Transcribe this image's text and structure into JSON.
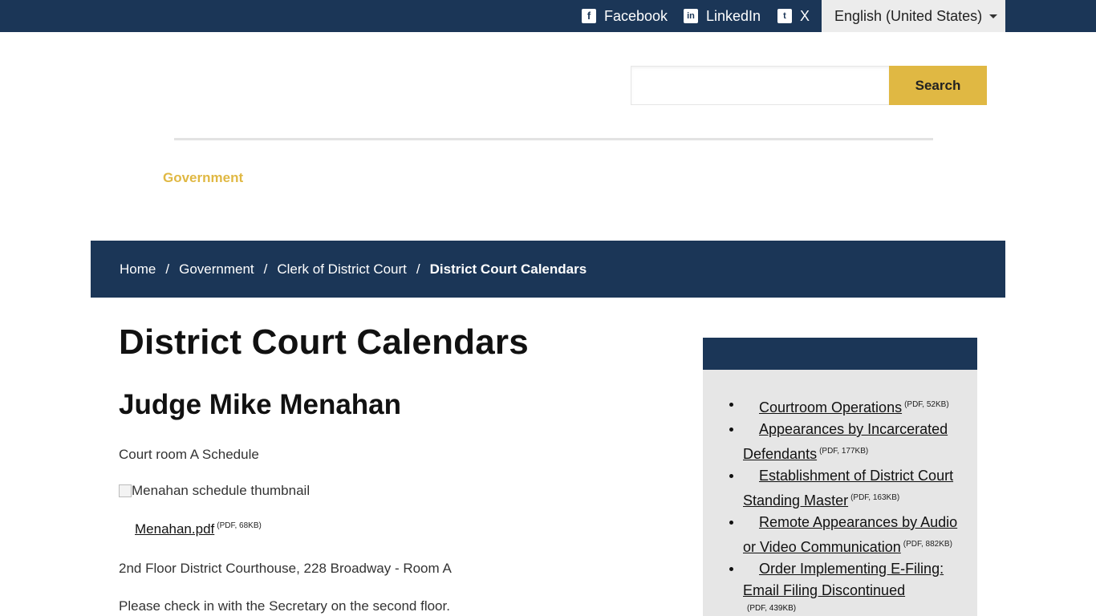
{
  "topbar": {
    "social": [
      {
        "label": "Facebook",
        "icon": "facebook-icon"
      },
      {
        "label": "LinkedIn",
        "icon": "linkedin-icon"
      },
      {
        "label": "X",
        "icon": "twitter-icon"
      }
    ],
    "language": "English (United States)"
  },
  "search": {
    "placeholder": "",
    "button_label": "Search"
  },
  "nav": {
    "government": "Government"
  },
  "breadcrumb": {
    "items": [
      "Home",
      "Government",
      "Clerk of District Court"
    ],
    "separator": "/",
    "current": "District Court Calendars"
  },
  "main": {
    "title": "District Court Calendars",
    "subtitle": "Judge Mike Menahan",
    "schedule_label": "Court room A Schedule",
    "thumbnail_alt": "Menahan schedule thumbnail",
    "file_link": "Menahan.pdf",
    "file_meta": "(PDF, 68KB)",
    "location": "2nd Floor District Courthouse, 228 Broadway - Room A",
    "checkin": "Please check in with the Secretary on the second floor."
  },
  "sidebar": {
    "items": [
      {
        "label": "Courtroom Operations",
        "meta": "(PDF, 52KB)"
      },
      {
        "label": "Appearances by Incarcerated Defendants",
        "meta": "(PDF, 177KB)"
      },
      {
        "label": "Establishment of District Court Standing Master",
        "meta": "(PDF, 163KB)"
      },
      {
        "label": "Remote Appearances by Audio or Video Communication",
        "meta": "(PDF, 882KB)"
      },
      {
        "label": "Order Implementing E-Filing: Email Filing Discontinued",
        "meta": "(PDF, 439KB)"
      }
    ]
  },
  "colors": {
    "navy": "#1b3657",
    "gold": "#e0b843",
    "sidebar_bg": "#e6e6e6"
  }
}
